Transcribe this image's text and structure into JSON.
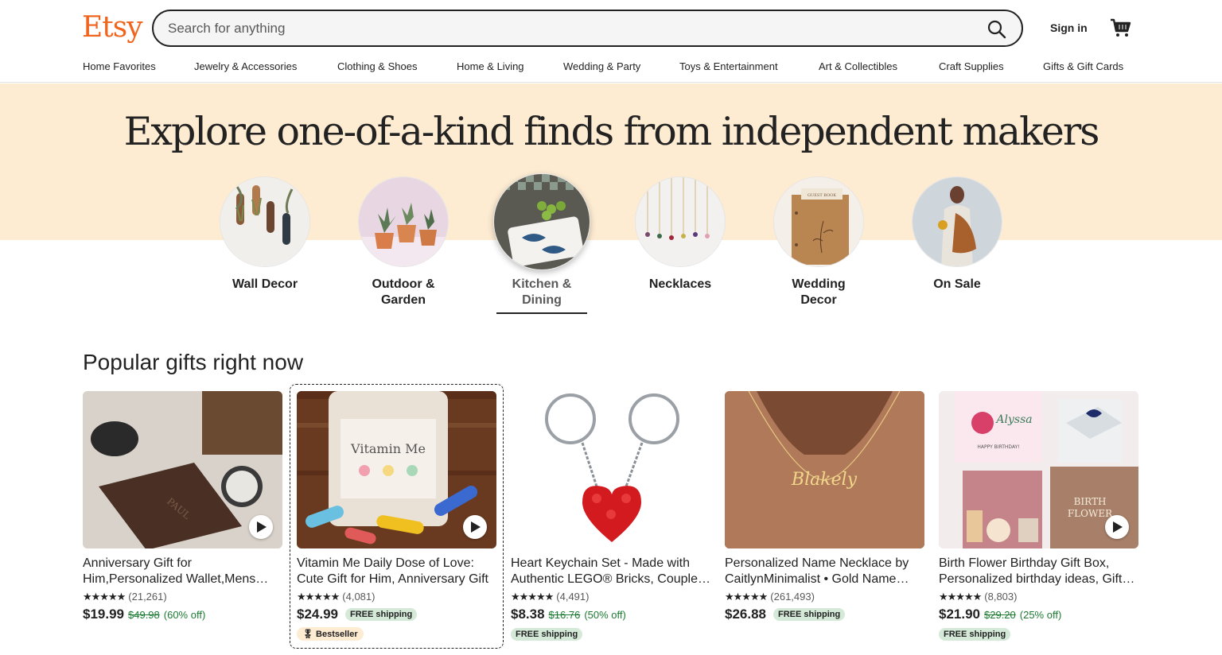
{
  "header": {
    "logo": "Etsy",
    "search_placeholder": "Search for anything",
    "signin_label": "Sign in"
  },
  "categories": [
    "Home Favorites",
    "Jewelry & Accessories",
    "Clothing & Shoes",
    "Home & Living",
    "Wedding & Party",
    "Toys & Entertainment",
    "Art & Collectibles",
    "Craft Supplies",
    "Gifts & Gift Cards"
  ],
  "hero": {
    "title": "Explore one-of-a-kind finds from independent makers",
    "circles": [
      {
        "label_line1": "Wall Decor",
        "label_line2": ""
      },
      {
        "label_line1": "Outdoor &",
        "label_line2": "Garden"
      },
      {
        "label_line1": "Kitchen &",
        "label_line2": "Dining"
      },
      {
        "label_line1": "Necklaces",
        "label_line2": ""
      },
      {
        "label_line1": "Wedding",
        "label_line2": "Decor"
      },
      {
        "label_line1": "On Sale",
        "label_line2": ""
      }
    ]
  },
  "popular": {
    "title": "Popular gifts right now",
    "items": [
      {
        "title": "Anniversary Gift for Him,Personalized Wallet,Mens Leather Wallet",
        "stars": "★★★★★",
        "reviews": "(21,261)",
        "price": "$19.99",
        "original_price": "$49.98",
        "discount": "(60% off)",
        "free_shipping": "",
        "badge": ""
      },
      {
        "title": "Vitamin Me Daily Dose of Love: Cute Gift for Him, Anniversary Gift",
        "stars": "★★★★★",
        "reviews": "(4,081)",
        "price": "$24.99",
        "original_price": "",
        "discount": "",
        "free_shipping": "FREE shipping",
        "badge": "Bestseller"
      },
      {
        "title": "Heart Keychain Set - Made with Authentic LEGO® Bricks, Couples Gift",
        "stars": "★★★★★",
        "reviews": "(4,491)",
        "price": "$8.38",
        "original_price": "$16.76",
        "discount": "(50% off)",
        "free_shipping": "FREE shipping",
        "badge": ""
      },
      {
        "title": "Personalized Name Necklace by CaitlynMinimalist • Gold Name Necklace",
        "stars": "★★★★★",
        "reviews": "(261,493)",
        "price": "$26.88",
        "original_price": "",
        "discount": "",
        "free_shipping": "FREE shipping",
        "badge": ""
      },
      {
        "title": "Birth Flower Birthday Gift Box, Personalized birthday ideas, Gift for Her",
        "stars": "★★★★★",
        "reviews": "(8,803)",
        "price": "$21.90",
        "original_price": "$29.20",
        "discount": "(25% off)",
        "free_shipping": "FREE shipping",
        "badge": ""
      }
    ]
  },
  "colors": {
    "brand": "#F1641E",
    "hero_bg": "#FDEBD2",
    "discount_green": "#1D7A33",
    "shipping_badge": "#D4E9D7"
  },
  "icons": [
    "search-icon",
    "cart-icon",
    "play-icon",
    "bestseller-icon"
  ]
}
